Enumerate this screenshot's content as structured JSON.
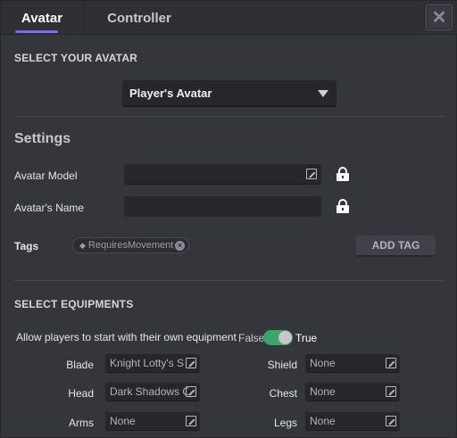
{
  "tabs": [
    {
      "label": "Avatar",
      "active": true
    },
    {
      "label": "Controller",
      "active": false
    }
  ],
  "close_icon": "close-icon",
  "select_avatar": {
    "heading": "SELECT YOUR AVATAR",
    "dropdown_value": "Player's Avatar"
  },
  "settings": {
    "heading": "Settings",
    "avatar_model_label": "Avatar Model",
    "avatar_model_value": "",
    "avatar_name_label": "Avatar's Name",
    "avatar_name_value": "",
    "tags_label": "Tags",
    "tag_chip": "RequiresMovement",
    "add_tag_label": "ADD TAG"
  },
  "equipment": {
    "heading": "SELECT EQUIPMENTS",
    "allow_label": "Allow players to start with their own equipment",
    "toggle_false": "False",
    "toggle_true": "True",
    "toggle_on": true,
    "slots": [
      {
        "label": "Blade",
        "value": "Knight Lotty's S"
      },
      {
        "label": "Shield",
        "value": "None"
      },
      {
        "label": "Head",
        "value": "Dark Shadows C"
      },
      {
        "label": "Chest",
        "value": "None"
      },
      {
        "label": "Arms",
        "value": "None"
      },
      {
        "label": "Legs",
        "value": "None"
      }
    ]
  },
  "colors": {
    "panel_bg": "#35353c",
    "input_bg": "#26262c",
    "accent_tab": "#6f6ff2",
    "toggle_on": "#3ea56a"
  }
}
